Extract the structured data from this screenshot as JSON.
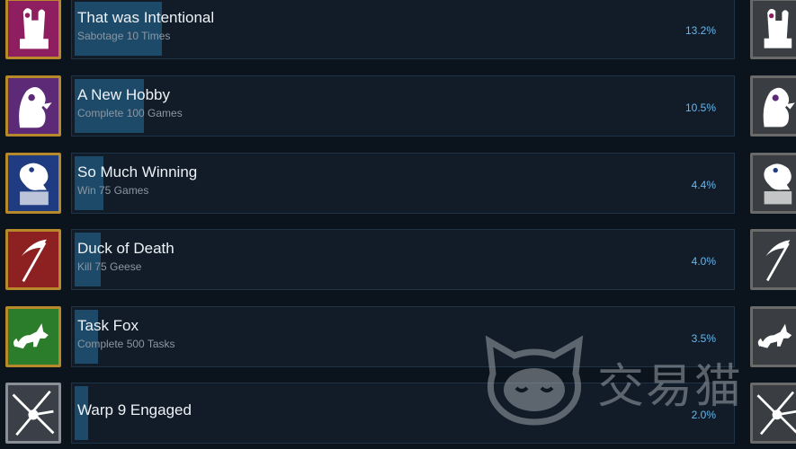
{
  "achievements": [
    {
      "title": "That was Intentional",
      "description": "Sabotage 10 Times",
      "percent": "13.2%",
      "progress": 0.132,
      "icon": "tombstone-icon",
      "bg": "#8e1e5f"
    },
    {
      "title": "A New Hobby",
      "description": "Complete 100 Games",
      "percent": "10.5%",
      "progress": 0.105,
      "icon": "ghost-duck-icon",
      "bg": "#5d2a78"
    },
    {
      "title": "So Much Winning",
      "description": "Win 75 Games",
      "percent": "4.4%",
      "progress": 0.044,
      "icon": "trophy-duck-icon",
      "bg": "#1f3b82"
    },
    {
      "title": "Duck of Death",
      "description": "Kill 75 Geese",
      "percent": "4.0%",
      "progress": 0.04,
      "icon": "scythe-icon",
      "bg": "#8d2020"
    },
    {
      "title": "Task Fox",
      "description": "Complete 500 Tasks",
      "percent": "3.5%",
      "progress": 0.035,
      "icon": "fox-icon",
      "bg": "#2b7d2c"
    },
    {
      "title": "Warp 9 Engaged",
      "description": "",
      "percent": "2.0%",
      "progress": 0.02,
      "icon": "warp-icon",
      "bg": "#3b4048"
    }
  ],
  "watermark": {
    "text": "交易猫",
    "icon": "cat-logo-icon"
  }
}
